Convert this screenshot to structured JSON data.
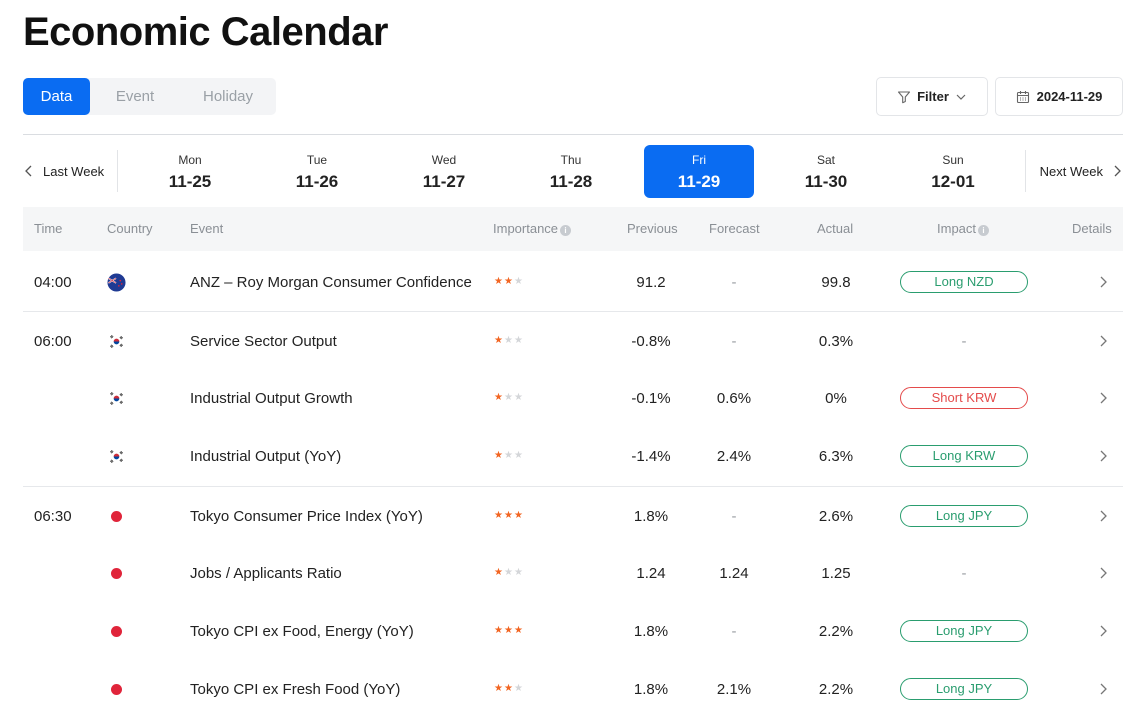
{
  "title": "Economic Calendar",
  "tabs": [
    {
      "label": "Data",
      "active": true
    },
    {
      "label": "Event",
      "active": false
    },
    {
      "label": "Holiday",
      "active": false
    }
  ],
  "filter_label": "Filter",
  "date_value": "2024-11-29",
  "week_nav": {
    "prev_label": "Last Week",
    "next_label": "Next Week",
    "days": [
      {
        "dow": "Mon",
        "date": "11-25",
        "selected": false
      },
      {
        "dow": "Tue",
        "date": "11-26",
        "selected": false
      },
      {
        "dow": "Wed",
        "date": "11-27",
        "selected": false
      },
      {
        "dow": "Thu",
        "date": "11-28",
        "selected": false
      },
      {
        "dow": "Fri",
        "date": "11-29",
        "selected": true
      },
      {
        "dow": "Sat",
        "date": "11-30",
        "selected": false
      },
      {
        "dow": "Sun",
        "date": "12-01",
        "selected": false
      }
    ]
  },
  "table": {
    "columns": [
      "Time",
      "Country",
      "Event",
      "Importance",
      "Previous",
      "Forecast",
      "Actual",
      "Impact",
      "Details"
    ],
    "rows": [
      {
        "time": "04:00",
        "country_icon": "new-zealand-flag-icon",
        "event": "ANZ – Roy Morgan Consumer Confidence",
        "importance": 2,
        "previous": "91.2",
        "forecast": "-",
        "actual": "99.8",
        "impact": "Long NZD",
        "impact_type": "long"
      },
      {
        "time": "06:00",
        "country_icon": "south-korea-flag-icon",
        "event": "Service Sector Output",
        "importance": 1,
        "previous": "-0.8%",
        "forecast": "-",
        "actual": "0.3%",
        "impact": "-",
        "impact_type": "none"
      },
      {
        "time": "",
        "country_icon": "south-korea-flag-icon",
        "event": "Industrial Output Growth",
        "importance": 1,
        "previous": "-0.1%",
        "forecast": "0.6%",
        "actual": "0%",
        "impact": "Short KRW",
        "impact_type": "short"
      },
      {
        "time": "",
        "country_icon": "south-korea-flag-icon",
        "event": "Industrial Output (YoY)",
        "importance": 1,
        "previous": "-1.4%",
        "forecast": "2.4%",
        "actual": "6.3%",
        "impact": "Long KRW",
        "impact_type": "long"
      },
      {
        "time": "06:30",
        "country_icon": "japan-flag-icon",
        "event": "Tokyo Consumer Price Index (YoY)",
        "importance": 3,
        "previous": "1.8%",
        "forecast": "-",
        "actual": "2.6%",
        "impact": "Long JPY",
        "impact_type": "long"
      },
      {
        "time": "",
        "country_icon": "japan-flag-icon",
        "event": "Jobs / Applicants Ratio",
        "importance": 1,
        "previous": "1.24",
        "forecast": "1.24",
        "actual": "1.25",
        "impact": "-",
        "impact_type": "none"
      },
      {
        "time": "",
        "country_icon": "japan-flag-icon",
        "event": "Tokyo CPI ex Food, Energy (YoY)",
        "importance": 3,
        "previous": "1.8%",
        "forecast": "-",
        "actual": "2.2%",
        "impact": "Long JPY",
        "impact_type": "long"
      },
      {
        "time": "",
        "country_icon": "japan-flag-icon",
        "event": "Tokyo CPI ex Fresh Food (YoY)",
        "importance": 2,
        "previous": "1.8%",
        "forecast": "2.1%",
        "actual": "2.2%",
        "impact": "Long JPY",
        "impact_type": "long"
      }
    ]
  },
  "colors": {
    "accent": "#0a6cf2",
    "star_on": "#f26522",
    "long": "#2a9d6f",
    "short": "#e44b4b"
  }
}
